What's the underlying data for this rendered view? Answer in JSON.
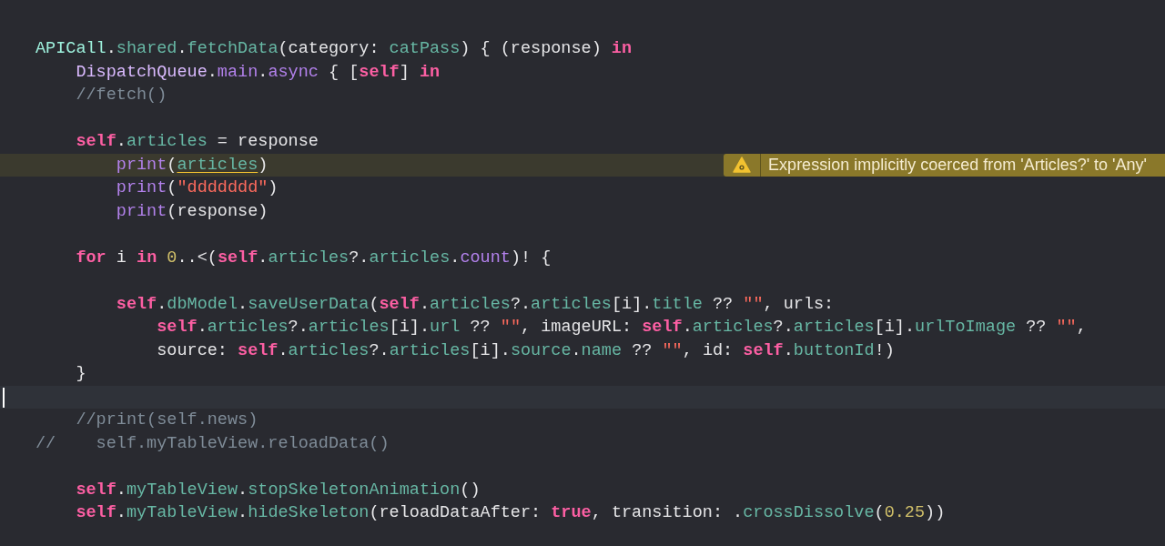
{
  "editor": {
    "lines": [
      {
        "kind": "code",
        "tokens": [
          {
            "kind": "project-type",
            "text": "APICall"
          },
          {
            "kind": "plain",
            "text": "."
          },
          {
            "kind": "project-member",
            "text": "shared"
          },
          {
            "kind": "plain",
            "text": "."
          },
          {
            "kind": "project-member",
            "text": "fetchData"
          },
          {
            "kind": "plain",
            "text": "(category: "
          },
          {
            "kind": "project-member",
            "text": "catPass"
          },
          {
            "kind": "plain",
            "text": ") { (response) "
          },
          {
            "kind": "keyword",
            "text": "in"
          }
        ],
        "children": [
          {
            "kind": "code",
            "tokens": [
              {
                "kind": "system-type",
                "text": "DispatchQueue"
              },
              {
                "kind": "plain",
                "text": "."
              },
              {
                "kind": "system-member",
                "text": "main"
              },
              {
                "kind": "plain",
                "text": "."
              },
              {
                "kind": "system-member",
                "text": "async"
              },
              {
                "kind": "plain",
                "text": " { ["
              },
              {
                "kind": "keyword",
                "text": "self"
              },
              {
                "kind": "plain",
                "text": "] "
              },
              {
                "kind": "keyword",
                "text": "in"
              }
            ]
          },
          {
            "kind": "code",
            "tokens": [
              {
                "kind": "comment",
                "text": "//fetch()"
              }
            ]
          },
          {
            "kind": "blank"
          },
          {
            "kind": "code",
            "tokens": [
              {
                "kind": "keyword",
                "text": "self"
              },
              {
                "kind": "plain",
                "text": "."
              },
              {
                "kind": "project-member",
                "text": "articles"
              },
              {
                "kind": "plain",
                "text": " = response"
              }
            ],
            "children": [
              {
                "kind": "code",
                "tokens": [
                  {
                    "kind": "system-member",
                    "text": "print"
                  },
                  {
                    "kind": "plain",
                    "text": "("
                  },
                  {
                    "kind": "flagged",
                    "text": "articles"
                  },
                  {
                    "kind": "plain",
                    "text": ")"
                  }
                ],
                "warning": {
                  "message": "Expression implicitly coerced from 'Articles?' to 'Any'"
                }
              },
              {
                "kind": "code",
                "tokens": [
                  {
                    "kind": "system-member",
                    "text": "print"
                  },
                  {
                    "kind": "plain",
                    "text": "("
                  },
                  {
                    "kind": "string",
                    "text": "\"ddddddd\""
                  },
                  {
                    "kind": "plain",
                    "text": ")"
                  }
                ]
              },
              {
                "kind": "code",
                "tokens": [
                  {
                    "kind": "system-member",
                    "text": "print"
                  },
                  {
                    "kind": "plain",
                    "text": "(response)"
                  }
                ]
              }
            ]
          },
          {
            "kind": "blank"
          },
          {
            "kind": "code",
            "tokens": [
              {
                "kind": "keyword",
                "text": "for"
              },
              {
                "kind": "plain",
                "text": " i "
              },
              {
                "kind": "keyword",
                "text": "in "
              },
              {
                "kind": "number",
                "text": "0"
              },
              {
                "kind": "plain",
                "text": "..<("
              },
              {
                "kind": "keyword",
                "text": "self"
              },
              {
                "kind": "plain",
                "text": "."
              },
              {
                "kind": "project-member",
                "text": "articles"
              },
              {
                "kind": "plain",
                "text": "?."
              },
              {
                "kind": "project-member",
                "text": "articles"
              },
              {
                "kind": "plain",
                "text": "."
              },
              {
                "kind": "system-member",
                "text": "count"
              },
              {
                "kind": "plain",
                "text": ")! {"
              }
            ],
            "children": [
              {
                "kind": "blank"
              },
              {
                "kind": "code",
                "tokens": [
                  {
                    "kind": "keyword",
                    "text": "self"
                  },
                  {
                    "kind": "plain",
                    "text": "."
                  },
                  {
                    "kind": "project-member",
                    "text": "dbModel"
                  },
                  {
                    "kind": "plain",
                    "text": "."
                  },
                  {
                    "kind": "project-member",
                    "text": "saveUserData"
                  },
                  {
                    "kind": "plain",
                    "text": "("
                  },
                  {
                    "kind": "keyword",
                    "text": "self"
                  },
                  {
                    "kind": "plain",
                    "text": "."
                  },
                  {
                    "kind": "project-member",
                    "text": "articles"
                  },
                  {
                    "kind": "plain",
                    "text": "?."
                  },
                  {
                    "kind": "project-member",
                    "text": "articles"
                  },
                  {
                    "kind": "plain",
                    "text": "[i]."
                  },
                  {
                    "kind": "project-member",
                    "text": "title"
                  },
                  {
                    "kind": "plain",
                    "text": " ?? "
                  },
                  {
                    "kind": "string",
                    "text": "\"\""
                  },
                  {
                    "kind": "plain",
                    "text": ", urls:"
                  }
                ],
                "children": [
                  {
                    "kind": "code",
                    "tokens": [
                      {
                        "kind": "keyword",
                        "text": "self"
                      },
                      {
                        "kind": "plain",
                        "text": "."
                      },
                      {
                        "kind": "project-member",
                        "text": "articles"
                      },
                      {
                        "kind": "plain",
                        "text": "?."
                      },
                      {
                        "kind": "project-member",
                        "text": "articles"
                      },
                      {
                        "kind": "plain",
                        "text": "[i]."
                      },
                      {
                        "kind": "project-member",
                        "text": "url"
                      },
                      {
                        "kind": "plain",
                        "text": " ?? "
                      },
                      {
                        "kind": "string",
                        "text": "\"\""
                      },
                      {
                        "kind": "plain",
                        "text": ", imageURL: "
                      },
                      {
                        "kind": "keyword",
                        "text": "self"
                      },
                      {
                        "kind": "plain",
                        "text": "."
                      },
                      {
                        "kind": "project-member",
                        "text": "articles"
                      },
                      {
                        "kind": "plain",
                        "text": "?."
                      },
                      {
                        "kind": "project-member",
                        "text": "articles"
                      },
                      {
                        "kind": "plain",
                        "text": "[i]."
                      },
                      {
                        "kind": "project-member",
                        "text": "urlToImage"
                      },
                      {
                        "kind": "plain",
                        "text": " ?? "
                      },
                      {
                        "kind": "string",
                        "text": "\"\""
                      },
                      {
                        "kind": "plain",
                        "text": ","
                      }
                    ]
                  },
                  {
                    "kind": "code",
                    "tokens": [
                      {
                        "kind": "plain",
                        "text": "source: "
                      },
                      {
                        "kind": "keyword",
                        "text": "self"
                      },
                      {
                        "kind": "plain",
                        "text": "."
                      },
                      {
                        "kind": "project-member",
                        "text": "articles"
                      },
                      {
                        "kind": "plain",
                        "text": "?."
                      },
                      {
                        "kind": "project-member",
                        "text": "articles"
                      },
                      {
                        "kind": "plain",
                        "text": "[i]."
                      },
                      {
                        "kind": "project-member",
                        "text": "source"
                      },
                      {
                        "kind": "plain",
                        "text": "."
                      },
                      {
                        "kind": "project-member",
                        "text": "name"
                      },
                      {
                        "kind": "plain",
                        "text": " ?? "
                      },
                      {
                        "kind": "string",
                        "text": "\"\""
                      },
                      {
                        "kind": "plain",
                        "text": ", id: "
                      },
                      {
                        "kind": "keyword",
                        "text": "self"
                      },
                      {
                        "kind": "plain",
                        "text": "."
                      },
                      {
                        "kind": "project-member",
                        "text": "buttonId"
                      },
                      {
                        "kind": "plain",
                        "text": "!)"
                      }
                    ]
                  }
                ]
              }
            ]
          },
          {
            "kind": "code",
            "tokens": [
              {
                "kind": "plain",
                "text": "}"
              }
            ]
          },
          {
            "kind": "current"
          },
          {
            "kind": "code",
            "tokens": [
              {
                "kind": "comment",
                "text": "//print(self.news)"
              }
            ]
          }
        ]
      },
      {
        "kind": "code",
        "tokens": [
          {
            "kind": "comment",
            "text": "//    self.myTableView.reloadData()"
          }
        ],
        "children": [
          {
            "kind": "blank"
          },
          {
            "kind": "code",
            "tokens": [
              {
                "kind": "keyword",
                "text": "self"
              },
              {
                "kind": "plain",
                "text": "."
              },
              {
                "kind": "project-member",
                "text": "myTableView"
              },
              {
                "kind": "plain",
                "text": "."
              },
              {
                "kind": "project-member",
                "text": "stopSkeletonAnimation"
              },
              {
                "kind": "plain",
                "text": "()"
              }
            ]
          },
          {
            "kind": "code",
            "tokens": [
              {
                "kind": "keyword",
                "text": "self"
              },
              {
                "kind": "plain",
                "text": "."
              },
              {
                "kind": "project-member",
                "text": "myTableView"
              },
              {
                "kind": "plain",
                "text": "."
              },
              {
                "kind": "project-member",
                "text": "hideSkeleton"
              },
              {
                "kind": "plain",
                "text": "(reloadDataAfter: "
              },
              {
                "kind": "keyword",
                "text": "true"
              },
              {
                "kind": "plain",
                "text": ", transition: ."
              },
              {
                "kind": "project-member",
                "text": "crossDissolve"
              },
              {
                "kind": "plain",
                "text": "("
              },
              {
                "kind": "number",
                "text": "0.25"
              },
              {
                "kind": "plain",
                "text": "))"
              }
            ]
          }
        ]
      }
    ]
  }
}
